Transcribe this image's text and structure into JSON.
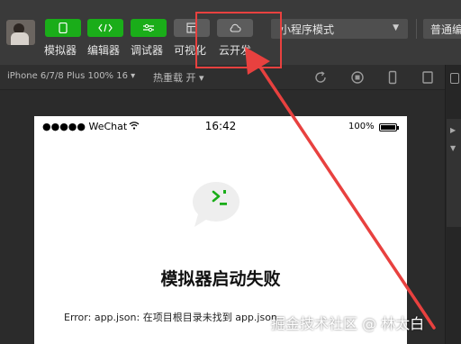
{
  "toolbar": {
    "tools": [
      {
        "label": "模拟器",
        "icon": "phone-icon"
      },
      {
        "label": "编辑器",
        "icon": "code-icon"
      },
      {
        "label": "调试器",
        "icon": "debug-sliders-icon"
      },
      {
        "label": "可视化",
        "icon": "layout-icon"
      },
      {
        "label": "云开发",
        "icon": "cloud-icon"
      }
    ],
    "mode_select": "小程序模式",
    "compile_select": "普通编"
  },
  "simulator": {
    "device": "iPhone 6/7/8 Plus 100% 16 ▾",
    "hot_reload": "热重载 开 ▾",
    "icons": [
      "rotate-icon",
      "stop-record-icon",
      "phone-outline-icon",
      "tablet-icon"
    ]
  },
  "phone": {
    "carrier": "●●●●● WeChat",
    "time": "16:42",
    "battery": "100%",
    "error_title": "模拟器启动失败",
    "error_message": "Error: app.json: 在项目根目录未找到 app.json"
  },
  "watermark": "掘金技术社区 @ 林太白",
  "colors": {
    "toolbar": "#3a3a3a",
    "accent_green": "#1aad19",
    "annotation_red": "#e8413f"
  }
}
